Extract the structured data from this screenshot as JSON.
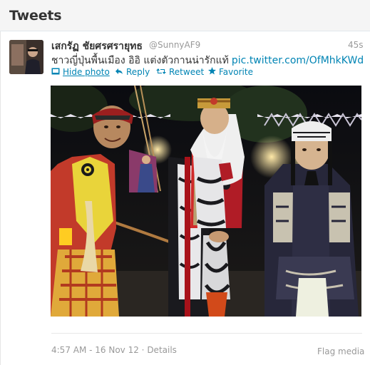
{
  "header": {
    "title": "Tweets"
  },
  "tweet": {
    "fullname": "เสกรัฏ ชัยศรศรายุทธ",
    "username": "@SunnyAF9",
    "time_ago": "45s",
    "text": "ชาวญี่ปุ่นพื้นเมือง อิอิ แต่งตัวกานน่ารักแท้",
    "link": "pic.twitter.com/OfMhkKWd",
    "actions": {
      "hide_photo": "Hide photo",
      "reply": "Reply",
      "retweet": "Retweet",
      "favorite": "Favorite"
    },
    "meta": "4:57 AM - 16 Nov 12 · Details",
    "flag_media": "Flag media"
  },
  "colors": {
    "link": "#0084b4",
    "muted": "#999999",
    "text": "#333333",
    "header_bg": "#f5f5f5"
  },
  "icons": [
    "photo-icon",
    "reply-arrow-icon",
    "retweet-icon",
    "star-icon"
  ]
}
